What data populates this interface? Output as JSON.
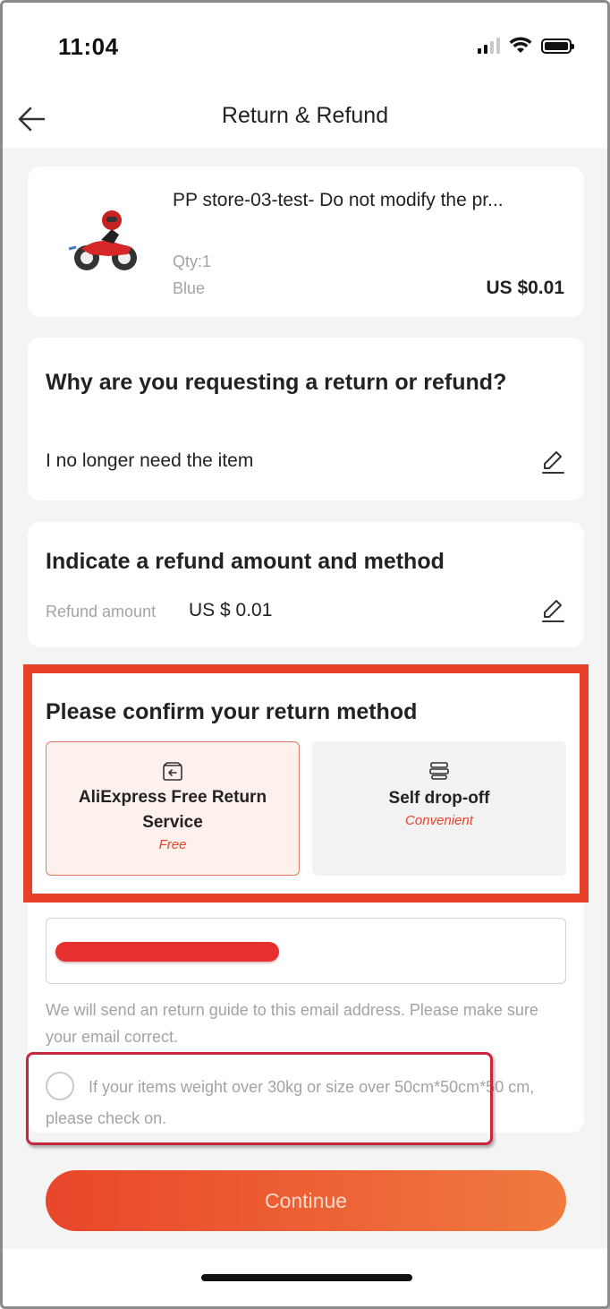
{
  "status_bar": {
    "time": "11:04"
  },
  "nav": {
    "title": "Return & Refund"
  },
  "product": {
    "title": "PP store-03-test- Do not modify the pr...",
    "qty": "Qty:1",
    "color": "Blue",
    "price": "US $0.01"
  },
  "reason": {
    "heading": "Why are you requesting a return or refund?",
    "value": "I no longer need the item"
  },
  "refund": {
    "heading": "Indicate a refund amount and method",
    "amount_label": "Refund amount",
    "amount_value": "US $ 0.01"
  },
  "return_method": {
    "heading": "Please confirm your return method",
    "options": [
      {
        "name": "AliExpress Free Return Service",
        "tag": "Free",
        "icon": "return-box-icon",
        "selected": true
      },
      {
        "name": "Self drop-off",
        "tag": "Convenient",
        "icon": "stack-icon",
        "selected": false
      }
    ],
    "email_hint": "We will send an return guide to this email address. Please make sure your email correct.",
    "weight_check_label": "If your items weight over 30kg or size over 50cm*50cm*50 cm, please check on.",
    "weight_check_checked": false
  },
  "continue_label": "Continue",
  "colors": {
    "accent": "#e8412a",
    "button_start": "#e8462a",
    "button_end": "#f07a3f",
    "annotation_red": "#e8412a"
  }
}
